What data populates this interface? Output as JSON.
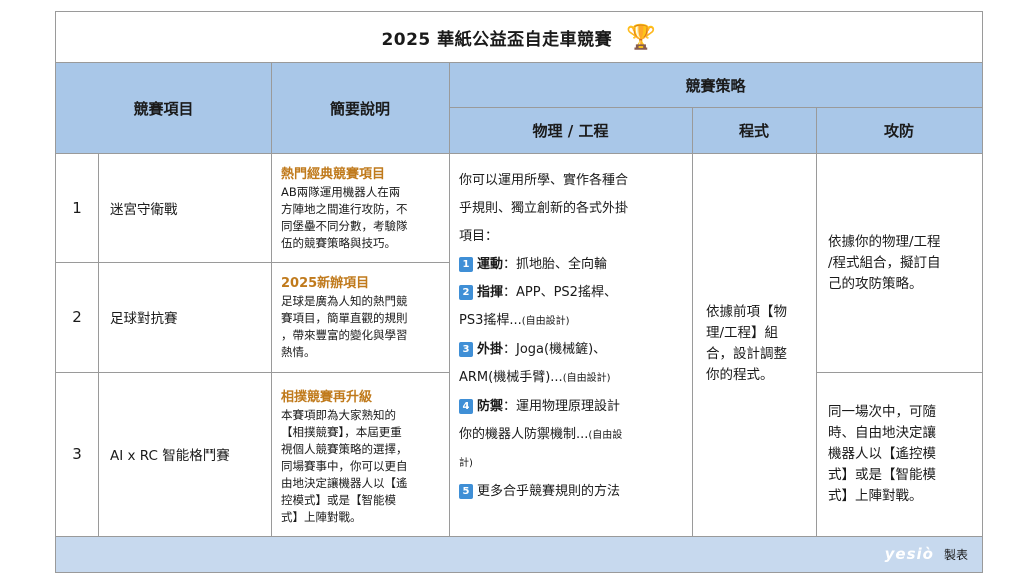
{
  "title": "2025 華紙公益盃自走車競賽",
  "trophy_icon": "trophy-icon",
  "headers": {
    "event": "競賽項目",
    "summary": "簡要說明",
    "strategy": "競賽策略",
    "physics": "物理 / 工程",
    "program": "程式",
    "attack": "攻防"
  },
  "rows": [
    {
      "num": "1",
      "name": "迷宮守衛戰",
      "desc_title": "熱門經典競賽項目",
      "desc_lines": [
        "AB兩隊運用機器人在兩",
        "方陣地之間進行攻防，不",
        "同堡壘不同分數，考驗隊",
        "伍的競賽策略與技巧。"
      ]
    },
    {
      "num": "2",
      "name": "足球對抗賽",
      "desc_title": "2025新辦項目",
      "desc_lines": [
        "足球是廣為人知的熱門競",
        "賽項目，簡單直觀的規則",
        "，帶來豐富的變化與學習",
        "熱情。"
      ]
    },
    {
      "num": "3",
      "name": "AI x RC 智能格鬥賽",
      "desc_title": "相撲競賽再升級",
      "desc_lines": [
        "本賽項即為大家熟知的",
        "【相撲競賽】，本屆更重",
        "視個人競賽策略的選擇，",
        "同場賽事中，你可以更自",
        "由地決定讓機器人以【遙",
        "控模式】或是【智能模",
        "式】上陣對戰。"
      ]
    }
  ],
  "physics": {
    "intro": [
      "你可以運用所學、實作各種合",
      "乎規則、獨立創新的各式外掛",
      "項目："
    ],
    "items": [
      {
        "n": "1",
        "label": "運動",
        "lines": [
          "：抓地胎、全向輪"
        ],
        "note": ""
      },
      {
        "n": "2",
        "label": "指揮",
        "lines": [
          "：APP、PS2搖桿、",
          "PS3搖桿..."
        ],
        "note": "(自由設計)"
      },
      {
        "n": "3",
        "label": "外掛",
        "lines": [
          "：Joga(機械鏟)、",
          "ARM(機械手臂)..."
        ],
        "note": "(自由設計)"
      },
      {
        "n": "4",
        "label": "防禦",
        "lines": [
          "：運用物理原理設計",
          "你的機器人防禦機制..."
        ],
        "note": "(自由設",
        "note2": "計)"
      },
      {
        "n": "5",
        "label": "",
        "lines": [
          "更多合乎競賽規則的方法"
        ],
        "note": ""
      }
    ]
  },
  "program_text": [
    "依據前項【物",
    "理/工程】組",
    "合，設計調整",
    "你的程式。"
  ],
  "attack_text_1": [
    "依據你的物理/工程",
    "/程式組合，擬訂自",
    "己的攻防策略。"
  ],
  "attack_text_2": [
    "同一場次中，可隨",
    "時、自由地決定讓",
    "機器人以【遙控模",
    "式】或是【智能模",
    "式】上陣對戰。"
  ],
  "footer": {
    "brand": "yesiò",
    "label": "製表"
  }
}
